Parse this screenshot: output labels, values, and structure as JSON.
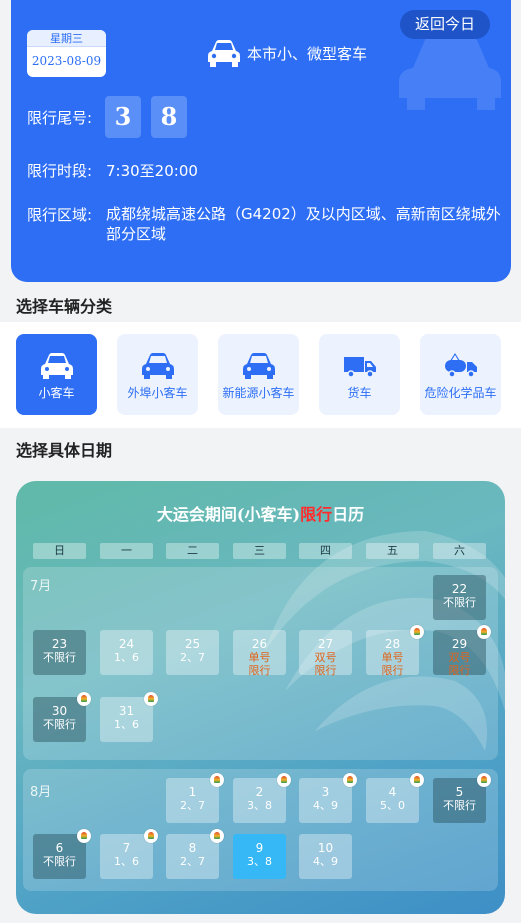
{
  "header": {
    "weekday": "星期三",
    "date": "2023-08-09",
    "back_today": "返回今日",
    "vehicle_type": "本市小、微型客车",
    "tail_label": "限行尾号:",
    "tail_digits": [
      "3",
      "8"
    ],
    "time_label": "限行时段:",
    "time_value": "7:30至20:00",
    "area_label": "限行区域:",
    "area_value": "成都绕城高速公路（G4202）及以内区域、高新南区绕城外部分区域"
  },
  "category_section": {
    "title": "选择车辆分类",
    "items": [
      {
        "label": "小客车",
        "icon": "car-icon",
        "active": true
      },
      {
        "label": "外埠小客车",
        "icon": "car-icon",
        "active": false
      },
      {
        "label": "新能源小客车",
        "icon": "car-icon",
        "active": false
      },
      {
        "label": "货车",
        "icon": "truck-icon",
        "active": false
      },
      {
        "label": "危险化学品车",
        "icon": "tanker-icon",
        "active": false
      }
    ]
  },
  "date_section": {
    "title": "选择具体日期"
  },
  "calendar": {
    "title_pre": "大运会期间(小客车)",
    "title_hl": "限行",
    "title_post": "日历",
    "weekdays": [
      "日",
      "一",
      "二",
      "三",
      "四",
      "五",
      "六"
    ],
    "july_label": "7月",
    "aug_label": "8月",
    "july": [
      {
        "day": "22",
        "text": "不限行",
        "style": "dark",
        "logo": false
      },
      {
        "day": "23",
        "text": "不限行",
        "style": "dark",
        "logo": false
      },
      {
        "day": "24",
        "text": "1、6",
        "style": "light",
        "logo": false
      },
      {
        "day": "25",
        "text": "2、7",
        "style": "light",
        "logo": false
      },
      {
        "day": "26",
        "text": "单号\n限行",
        "style": "light warn",
        "logo": false
      },
      {
        "day": "27",
        "text": "双号\n限行",
        "style": "light warn",
        "logo": false
      },
      {
        "day": "28",
        "text": "单号\n限行",
        "style": "light warn",
        "logo": true
      },
      {
        "day": "29",
        "text": "双号\n限行",
        "style": "dark warn",
        "logo": true
      },
      {
        "day": "30",
        "text": "不限行",
        "style": "dark",
        "logo": true
      },
      {
        "day": "31",
        "text": "1、6",
        "style": "light",
        "logo": true
      }
    ],
    "august": [
      {
        "day": "1",
        "text": "2、7",
        "style": "light",
        "logo": true
      },
      {
        "day": "2",
        "text": "3、8",
        "style": "light",
        "logo": true
      },
      {
        "day": "3",
        "text": "4、9",
        "style": "light",
        "logo": true
      },
      {
        "day": "4",
        "text": "5、0",
        "style": "light",
        "logo": true
      },
      {
        "day": "5",
        "text": "不限行",
        "style": "dark",
        "logo": true
      },
      {
        "day": "6",
        "text": "不限行",
        "style": "dark",
        "logo": true
      },
      {
        "day": "7",
        "text": "1、6",
        "style": "light",
        "logo": true
      },
      {
        "day": "8",
        "text": "2、7",
        "style": "light",
        "logo": true
      },
      {
        "day": "9",
        "text": "3、8",
        "style": "sel",
        "logo": false
      },
      {
        "day": "10",
        "text": "4、9",
        "style": "light",
        "logo": false
      }
    ]
  },
  "colors": {
    "primary": "#2d6ef5",
    "warn": "#e0641a",
    "selected": "#35b8f5",
    "title_highlight": "#ff2d2d"
  }
}
